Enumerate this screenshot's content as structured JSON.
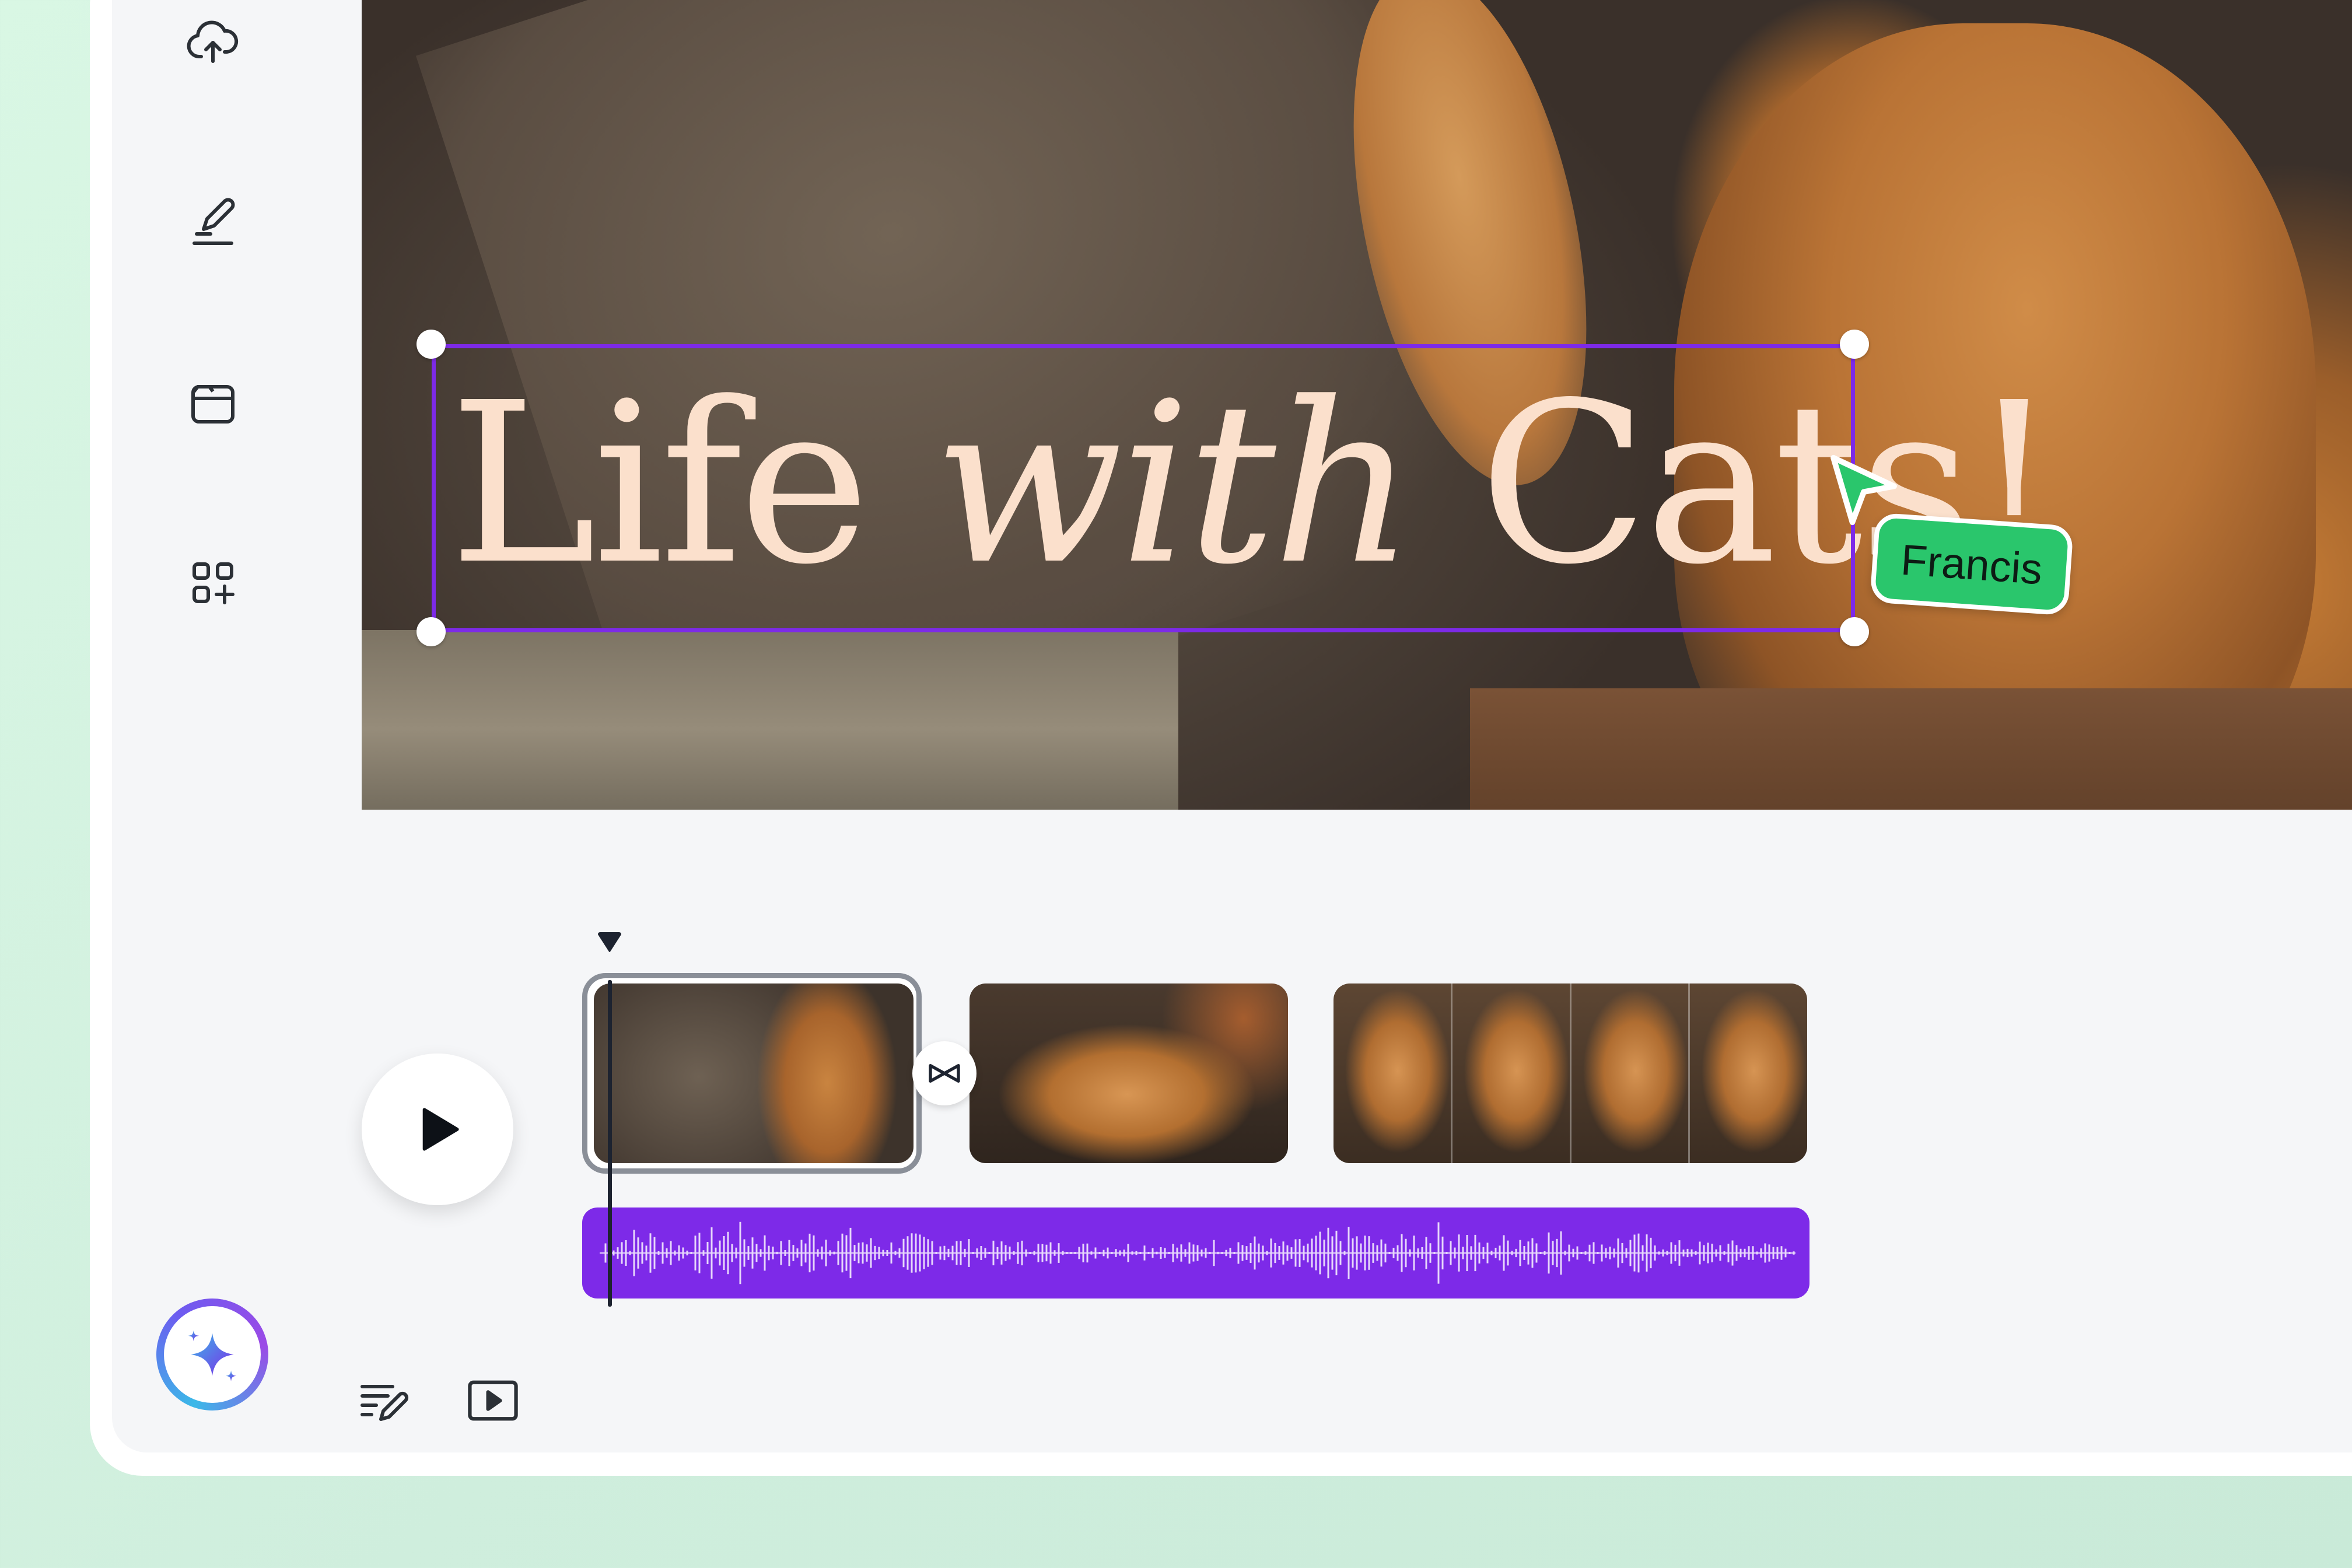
{
  "app": {
    "accent_color": "#7d2ae8",
    "collaborator_color": "#2ac66c"
  },
  "sidebar": {
    "items": [
      {
        "icon": "cloud-upload-icon"
      },
      {
        "icon": "draw-pen-icon"
      },
      {
        "icon": "folder-icon"
      },
      {
        "icon": "apps-add-icon"
      }
    ]
  },
  "canvas": {
    "title_part1": "Life ",
    "title_part2": "with",
    "title_part3": " Cats!",
    "collaborator_name": "Francis"
  },
  "timeline": {
    "clips": [
      {
        "thumbnail": "person-high-five-cat",
        "selected": true
      },
      {
        "thumbnail": "cat-lying-with-person"
      },
      {
        "thumbnail": "cat-sequence-frames",
        "frames": 4
      }
    ],
    "transition_icon": "bowtie-transition-icon",
    "audio_track_color": "#7d2ae8"
  },
  "bottom_bar": {
    "tools": [
      {
        "icon": "notes-edit-icon"
      },
      {
        "icon": "present-play-icon"
      }
    ],
    "magic_icon": "sparkle-icon"
  }
}
